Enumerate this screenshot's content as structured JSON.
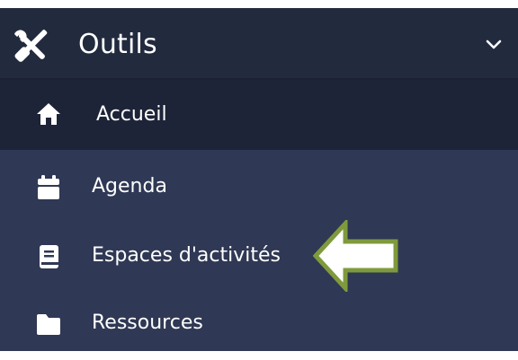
{
  "menu": {
    "title": "Outils",
    "title_icon": "tools-icon",
    "toggle_icon": "chevron-down-icon",
    "items": [
      {
        "label": "Accueil",
        "icon": "home-icon",
        "active": true
      },
      {
        "label": "Agenda",
        "icon": "calendar-icon",
        "active": false
      },
      {
        "label": "Espaces d'activités",
        "icon": "book-icon",
        "active": false
      },
      {
        "label": "Ressources",
        "icon": "folder-icon",
        "active": false
      }
    ]
  },
  "annotation": {
    "icon": "left-arrow-icon",
    "fill_color": "#ffffff",
    "stroke_color": "#7f9a3c"
  },
  "colors": {
    "header_bg": "#222a3e",
    "menu_bg": "#2f3854",
    "active_item_bg": "#1e2438",
    "text": "#ffffff"
  }
}
